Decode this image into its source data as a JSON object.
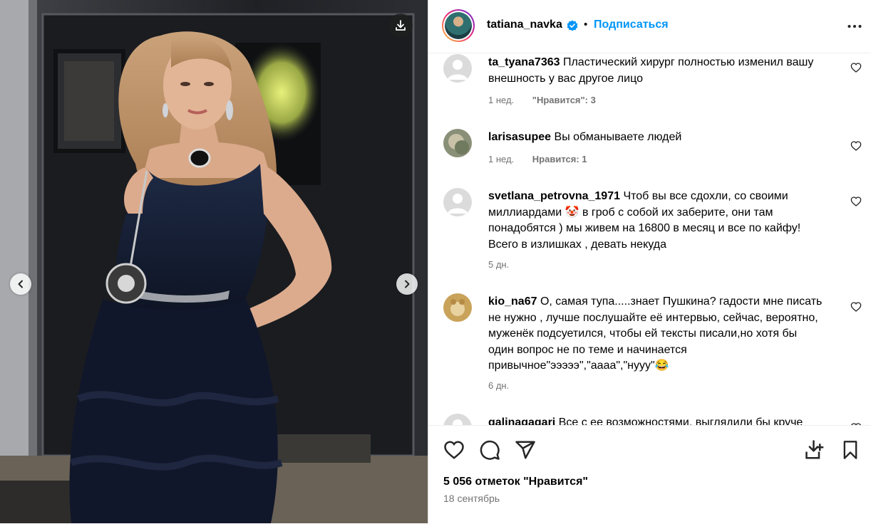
{
  "post": {
    "username": "tatiana_navka",
    "separator": "•",
    "follow_label": "Подписаться",
    "likes": "5 056 отметок \"Нравится\"",
    "date": "18 сентябрь"
  },
  "comments": [
    {
      "username": "ta_tyana7363",
      "text": "Пластический хирург полностью изменил вашу внешность у вас другое лицо",
      "time": "1 нед.",
      "likes": "\"Нравится\": 3"
    },
    {
      "username": "larisasupee",
      "text": "Вы обманываете людей",
      "time": "1 нед.",
      "likes": "Нравится: 1"
    },
    {
      "username": "svetlana_petrovna_1971",
      "text": "Чтоб вы все сдохли, со своими миллиардами 🤡 в гроб с собой их заберите, они там понадобятся ) мы живем на 16800 в месяц и все по кайфу! Всего в излишках , девать некуда",
      "time": "5 дн.",
      "likes": ""
    },
    {
      "username": "kio_na67",
      "text": "О, самая тупа.....знает Пушкина? гадости мне писать не нужно , лучше послушайте её интервью, сейчас, вероятно, муженёк подсуетился, чтобы ей тексты писали,но хотя бы один вопрос не по теме и начинается привычное\"эээээ\",\"аааа\",\"нууу\"😂",
      "time": "6 дн.",
      "likes": ""
    },
    {
      "username": "galinagagari",
      "text": "Все с ее возможностями, выглядили бы круче",
      "time": "",
      "likes": ""
    }
  ],
  "icons": {
    "download": "download-icon",
    "prev": "chevron-left-icon",
    "next": "chevron-right-icon",
    "verified": "verified-badge-icon",
    "more": "more-options-icon",
    "like": "heart-icon",
    "comment": "comment-icon",
    "share": "share-icon",
    "save_media": "save-to-device-icon",
    "bookmark": "bookmark-icon"
  },
  "colors": {
    "accent": "#0095f6",
    "muted": "#737373",
    "divider": "#efefef"
  }
}
